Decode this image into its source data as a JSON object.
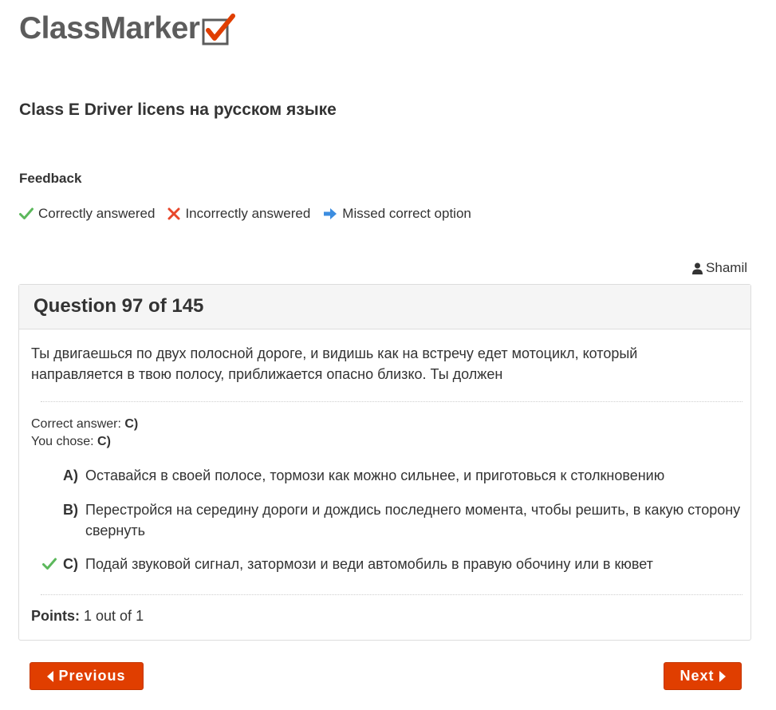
{
  "logo": {
    "text": "ClassMarker"
  },
  "quiz": {
    "title": "Class E Driver licens на русском языке"
  },
  "feedback": {
    "title": "Feedback",
    "legend": {
      "correct": "Correctly answered",
      "incorrect": "Incorrectly answered",
      "missed": "Missed correct option"
    }
  },
  "user": {
    "name": "Shamil"
  },
  "question": {
    "header": "Question 97 of 145",
    "text": "Ты двигаешься по двух полосной дороге, и видишь как на встречу едет мотоцикл, который направляется в твою полосу, приближается опасно близко. Ты должен",
    "correct_label": "Correct answer:",
    "correct_value": "C)",
    "chose_label": "You chose:",
    "chose_value": "C)",
    "options": [
      {
        "letter": "A)",
        "text": "Оставайся в своей полосе, тормози как можно сильнее, и приготовься к столкновению"
      },
      {
        "letter": "B)",
        "text": "Перестройся на середину дороги и дождись последнего момента, чтобы решить, в какую сторону свернуть"
      },
      {
        "letter": "C)",
        "text": "Подай звуковой сигнал, затормози и веди автомобиль в правую обочину или в кювет"
      }
    ],
    "points_label": "Points:",
    "points_value": "1 out of 1"
  },
  "nav": {
    "previous": "Previous",
    "next": "Next"
  },
  "colors": {
    "correct": "#5cb85c",
    "incorrect": "#e8472b",
    "missed": "#3c8de0",
    "button": "#e03e00",
    "logo_text": "#5c5c5c"
  },
  "icons": {
    "correct": "check-icon",
    "incorrect": "cross-icon",
    "missed": "arrow-right-icon",
    "user": "user-icon",
    "prev": "caret-left-icon",
    "next": "caret-right-icon"
  }
}
